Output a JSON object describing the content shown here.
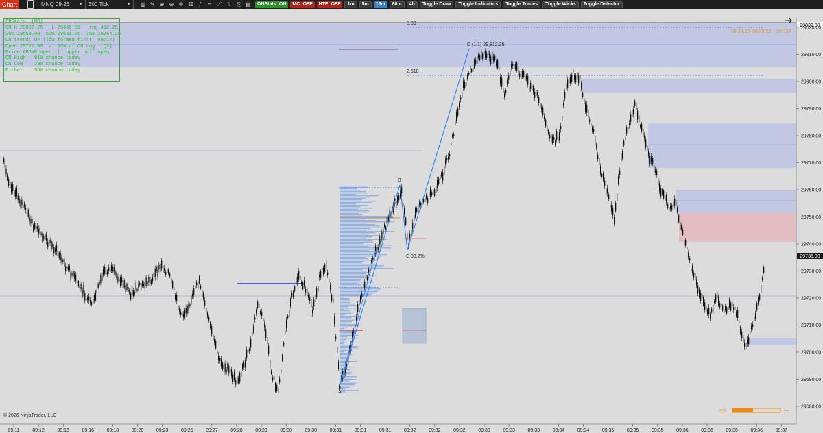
{
  "toolbar": {
    "chart_tab": "Chart",
    "instrument": "MNQ 09-26",
    "period": "300 Tick",
    "onstats": "ONStats: ON",
    "mc": "MC: OFF",
    "htf": "HTF: OFF",
    "timeframes": [
      "1m",
      "5m",
      "15m",
      "60m",
      "4h"
    ],
    "active_timeframe": "15m",
    "toggles": [
      "Toggle Draw",
      "Toggle Indicators",
      "Toggle Trades",
      "Toggle Wicks",
      "Toggle Detector"
    ]
  },
  "stats": {
    "lines": [
      "ONStats  [NQ]",
      "ON H 29867.25   L 29455.00   rng 412.25",
      "25% 29558.00  50% 29661.25  75% 29764.25",
      "ON trend: UP (low formed first, 00:17)",
      "Open 29721.00  =  65% of ON rng  (Q3)",
      "Price ABOVE open  |  upper half open",
      "ON High:  81% chance today",
      "ON Low :  29% chance today",
      "Either :  96% chance today"
    ]
  },
  "price_axis": {
    "labels": [
      "29820.00",
      "29810.00",
      "29800.00",
      "29790.00",
      "29780.00",
      "29770.00",
      "29760.00",
      "29750.00",
      "29740.00",
      "29730.00",
      "29720.00",
      "29710.00",
      "29700.00",
      "29690.00",
      "29680.00"
    ],
    "top_price": "29822.00",
    "current_price": "29736.00"
  },
  "time_axis": {
    "labels": [
      "09:11",
      "09:12",
      "09:15",
      "09:16",
      "09:18",
      "09:20",
      "09:23",
      "09:25",
      "09:27",
      "09:28",
      "09:29",
      "09:30",
      "09:30",
      "09:31",
      "09:31",
      "09:31",
      "09:32",
      "09:32",
      "09:32",
      "09:33",
      "09:33",
      "09:33",
      "09:34",
      "09:34",
      "09:35",
      "09:35",
      "09:35",
      "09:36",
      "09:36",
      "09:36",
      "09:36",
      "09:37"
    ]
  },
  "annotations": {
    "fib_3_33": "3.33",
    "fib_2_618": "2.618",
    "point_d": "D (1.1)  29,812.25",
    "point_b": "B",
    "point_c": "C  33.2%",
    "point_a": "A",
    "timer_labels": [
      "09:38:22",
      "09:38:22",
      "00.738"
    ],
    "tick_count": "125"
  },
  "copyright": "© 2026 NinjaTrader, LLC",
  "colors": {
    "background": "#dcdcdc",
    "zone_blue": "#b9c2e6",
    "zone_red": "#e4b7bc",
    "candle": "#111111",
    "fib_line": "#2d6fe0",
    "stats_text": "#26c026"
  }
}
